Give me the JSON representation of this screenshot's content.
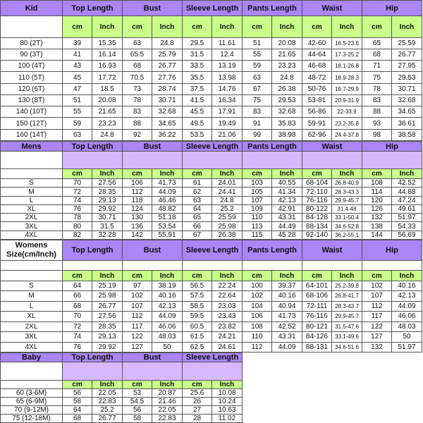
{
  "headers": [
    "Top Length",
    "Bust",
    "Sleeve Length",
    "Pants Length",
    "Waist",
    "Hip"
  ],
  "baby_headers": [
    "Top Length",
    "Bust",
    "Sleeve Length"
  ],
  "units": [
    "cm",
    "Inch"
  ],
  "kid": {
    "title": "Kid",
    "rows": [
      [
        "80 (2T)",
        "39",
        "15.35",
        "63",
        "24.8",
        "29.5",
        "11.61",
        "51",
        "20.08",
        "42-60",
        "16.5-23.6",
        "65",
        "25.59"
      ],
      [
        "90 (3T)",
        "41",
        "16.14",
        "65.5",
        "25.79",
        "31.5",
        "12.4",
        "55",
        "21.65",
        "44-64",
        "17.3-25.2",
        "68",
        "26.77"
      ],
      [
        "100 (4T)",
        "43",
        "16.93",
        "68",
        "26.77",
        "33.5",
        "13.19",
        "59",
        "23.23",
        "46-68",
        "18.1-26.8",
        "71",
        "27.95"
      ],
      [
        "110 (5T)",
        "45",
        "17.72",
        "70.5",
        "27.76",
        "35.5",
        "13.98",
        "63",
        "24.8",
        "48-72",
        "18.9-28.3",
        "75",
        "29.53"
      ],
      [
        "120 (6T)",
        "47",
        "18.5",
        "73",
        "28.74",
        "37.5",
        "14.76",
        "67",
        "26.38",
        "50-76",
        "19.7-29.9",
        "78",
        "30.71"
      ],
      [
        "130 (8T)",
        "51",
        "20.08",
        "78",
        "30.71",
        "41.5",
        "16.34",
        "75",
        "29.53",
        "53-81",
        "20.9-31.9",
        "83",
        "32.68"
      ],
      [
        "140 (10T)",
        "55",
        "21.65",
        "83",
        "32.68",
        "45.5",
        "17.91",
        "83",
        "32.68",
        "56-86",
        "22-33.9",
        "88",
        "34.65"
      ],
      [
        "150 (12T)",
        "59",
        "23.23",
        "88",
        "34.65",
        "49.5",
        "19.49",
        "91",
        "35.83",
        "59-91",
        "23.2-35.8",
        "93",
        "36.61"
      ],
      [
        "160 (14T)",
        "63",
        "24.8",
        "92",
        "36.22",
        "53.5",
        "21.06",
        "99",
        "38.98",
        "62-96",
        "24.4-37.8",
        "98",
        "38.58"
      ]
    ]
  },
  "mens": {
    "title": "Mens",
    "rows": [
      [
        "S",
        "70",
        "27.56",
        "106",
        "41.73",
        "61",
        "24.01",
        "103",
        "40.55",
        "68-104",
        "26.8-40.9",
        "108",
        "42.52"
      ],
      [
        "M",
        "72",
        "28.35",
        "112",
        "44.09",
        "62",
        "24.41",
        "105",
        "41.34",
        "72-110",
        "28.3-43.3",
        "114",
        "44.88"
      ],
      [
        "L",
        "74",
        "29.13",
        "118",
        "46.46",
        "63",
        "24.8",
        "107",
        "42.13",
        "76-116",
        "29.9-45.7",
        "120",
        "47.24"
      ],
      [
        "XL",
        "76",
        "29.92",
        "124",
        "48.82",
        "64",
        "25.2",
        "109",
        "42.91",
        "80-122",
        "31.4-48",
        "126",
        "49.61"
      ],
      [
        "2XL",
        "78",
        "30.71",
        "130",
        "51.18",
        "65",
        "25.59",
        "110",
        "43.31",
        "84-128",
        "33.1-50.4",
        "132",
        "51.97"
      ],
      [
        "3XL",
        "80",
        "31.5",
        "136",
        "53.54",
        "66",
        "25.98",
        "113",
        "44.49",
        "88-134",
        "34.6-52.8",
        "138",
        "54.33"
      ],
      [
        "4XL",
        "82",
        "32.28",
        "142",
        "55.91",
        "67",
        "26.38",
        "115",
        "45.28",
        "92-140",
        "36.2-55.1",
        "144",
        "56.69"
      ]
    ]
  },
  "womens": {
    "title": "Womens Size(cm/Inch)",
    "rows": [
      [
        "S",
        "64",
        "25.19",
        "97",
        "38.19",
        "56.5",
        "22.24",
        "100",
        "39.37",
        "64-101",
        "25.2-39.8",
        "102",
        "40.16"
      ],
      [
        "M",
        "66",
        "25.98",
        "102",
        "40.16",
        "57.5",
        "22.64",
        "102",
        "40.16",
        "68-106",
        "26.8-41.7",
        "107",
        "42.13"
      ],
      [
        "L",
        "68",
        "26.77",
        "107",
        "42.13",
        "58.5",
        "23.03",
        "104",
        "40.94",
        "72-111",
        "28.3-43.7",
        "112",
        "44.09"
      ],
      [
        "XL",
        "70",
        "27.56",
        "112",
        "44.09",
        "59.5",
        "23.43",
        "106",
        "41.73",
        "76-116",
        "29.9-45.7",
        "117",
        "46.06"
      ],
      [
        "2XL",
        "72",
        "28.35",
        "117",
        "46.06",
        "60.5",
        "23.82",
        "108",
        "42.52",
        "80-121",
        "31.5-47.6",
        "122",
        "48.03"
      ],
      [
        "3XL",
        "74",
        "29.13",
        "122",
        "48.03",
        "61.5",
        "24.21",
        "110",
        "43.31",
        "84-126",
        "33.1-49.6",
        "127",
        "50"
      ],
      [
        "4XL",
        "76",
        "29.92",
        "127",
        "50",
        "62.5",
        "24.61",
        "112",
        "44.09",
        "88-131",
        "34.6-51.6",
        "132",
        "51.97"
      ]
    ]
  },
  "baby": {
    "title": "Baby",
    "rows": [
      [
        "60 (3-6M)",
        "56",
        "22.05",
        "53",
        "20.87",
        "25.6",
        "10.08"
      ],
      [
        "65 (6-9M)",
        "58",
        "22.83",
        "54.5",
        "21.46",
        "26",
        "10.24"
      ],
      [
        "70 (9-12M)",
        "64",
        "25.2",
        "56",
        "22.05",
        "27",
        "10.63"
      ],
      [
        "75 (12-18M)",
        "68",
        "26.77",
        "58",
        "22.83",
        "28",
        "11.02"
      ]
    ]
  }
}
